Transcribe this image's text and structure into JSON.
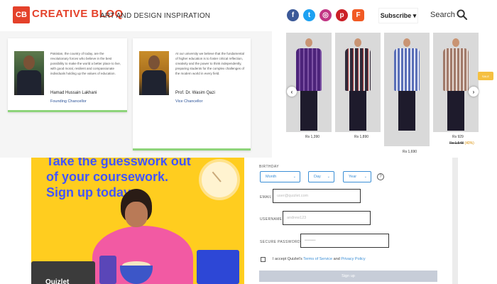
{
  "header": {
    "logo_mark": "CB",
    "brand": "CREATIVE BLOQ",
    "tagline": "ART AND DESIGN INSPIRATION",
    "social": [
      "facebook-icon",
      "twitter-icon",
      "instagram-icon",
      "pinterest-icon",
      "flipboard-icon"
    ],
    "subscribe_label": "Subscribe ▾",
    "search_label": "Search",
    "accent_color": "#e4412a"
  },
  "leaders": [
    {
      "quote": "Pakistan, the country of today, are the revolutionary forces who believe in the best possibility to make the world a better place to live, with good moral, resilient and compassionate individuals holding up the values of education.",
      "name": "Hamad Hussain Lakhani",
      "role": "Founding Chancellor"
    },
    {
      "quote": "At our university we believe that the fundamental of higher education is to foster critical reflection, creativity and the power to think independently, preparing students for the complex challenges of the modern world in every field.",
      "name": "Prof. Dr. Wasim Qazi",
      "role": "Vice Chancellor"
    }
  ],
  "carousel": {
    "prices": [
      "Rs 1,390",
      "Rs 1,890",
      "Rs 1,690",
      "Rs 929"
    ],
    "last_price_old": "Rs 1,548",
    "last_price_discount": "(40%)",
    "badge": "SALE",
    "prev_icon": "‹",
    "next_icon": "›"
  },
  "promo": {
    "headline_lines": [
      "Take the guesswork out",
      "of your coursework.",
      "Sign up today."
    ],
    "brand_on_laptop": "Quizlet",
    "bg_color": "#ffcd1f",
    "headline_color": "#4255ff"
  },
  "form": {
    "birthday_label": "BIRTHDAY",
    "month": "Month",
    "day": "Day",
    "year": "Year",
    "email_label": "EMAIL",
    "email_placeholder": "user@quizlet.com",
    "username_label": "USERNAME",
    "username_placeholder": "andrew123",
    "password_label": "SECURE PASSWORD",
    "password_placeholder": "••••••••",
    "terms_prefix": "I accept Quizlet's ",
    "terms_link": "Terms of Service",
    "terms_and": " and ",
    "privacy_link": "Privacy Policy",
    "signup_label": "Sign up",
    "accent_color": "#3b8fd6"
  }
}
